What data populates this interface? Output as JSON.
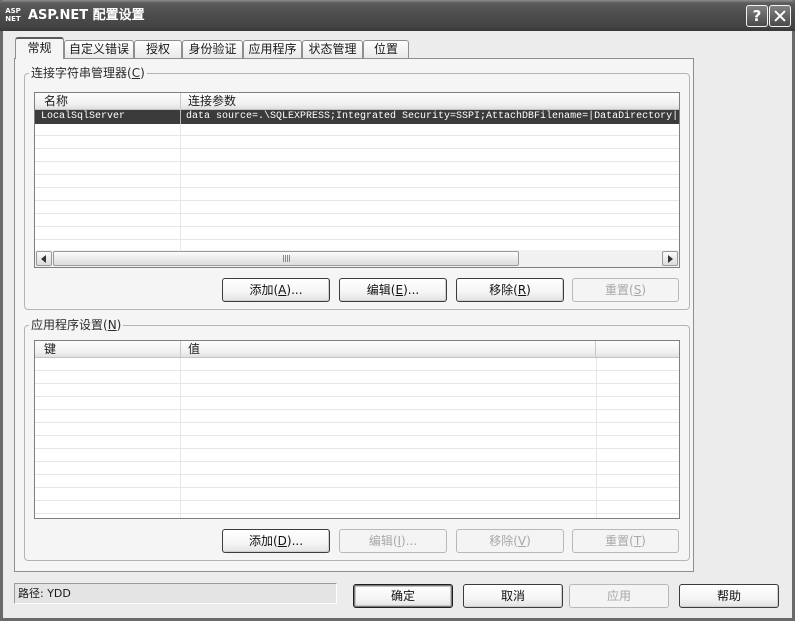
{
  "window": {
    "logo_top": "ASP",
    "logo_bottom": "NET",
    "title": "ASP.NET 配置设置",
    "help_glyph": "?"
  },
  "theme": {
    "title_bar": "#4d4d4d",
    "selection_bg": "#3b3b3b",
    "selection_text": "#ffffff",
    "dialog_bg": "#ececec",
    "page_bg": "#f5f5f5"
  },
  "icons": {
    "app_logo": "aspnet-logo-icon",
    "help": "help-icon",
    "close": "close-icon",
    "scroll_left": "chevron-left-icon",
    "scroll_right": "chevron-right-icon"
  },
  "tabs": [
    {
      "label": "常规",
      "selected": true
    },
    {
      "label": "自定义错误",
      "selected": false
    },
    {
      "label": "授权",
      "selected": false
    },
    {
      "label": "身份验证",
      "selected": false
    },
    {
      "label": "应用程序",
      "selected": false
    },
    {
      "label": "状态管理",
      "selected": false
    },
    {
      "label": "位置",
      "selected": false
    }
  ],
  "connection_strings": {
    "group_label": {
      "pre": "连接字符串管理器(",
      "key": "C",
      "post": ")"
    },
    "columns": [
      "名称",
      "连接参数"
    ],
    "rows": [
      {
        "name": "LocalSqlServer",
        "parameters": "data source=.\\SQLEXPRESS;Integrated Security=SSPI;AttachDBFilename=|DataDirectory|",
        "selected": true
      }
    ],
    "buttons": [
      {
        "pre": "添加(",
        "key": "A",
        "post": ")...",
        "enabled": true
      },
      {
        "pre": "编辑(",
        "key": "E",
        "post": ")...",
        "enabled": true
      },
      {
        "pre": "移除(",
        "key": "R",
        "post": ")",
        "enabled": true
      },
      {
        "pre": "重置(",
        "key": "S",
        "post": ")",
        "enabled": false
      }
    ]
  },
  "app_settings": {
    "group_label": {
      "pre": "应用程序设置(",
      "key": "N",
      "post": ")"
    },
    "columns": [
      "键",
      "值"
    ],
    "rows": [],
    "buttons": [
      {
        "pre": "添加(",
        "key": "D",
        "post": ")...",
        "enabled": true
      },
      {
        "pre": "编辑(",
        "key": "I",
        "post": ")...",
        "enabled": false
      },
      {
        "pre": "移除(",
        "key": "V",
        "post": ")",
        "enabled": false
      },
      {
        "pre": "重置(",
        "key": "T",
        "post": ")",
        "enabled": false
      }
    ]
  },
  "status": {
    "path": "路径: YDD"
  },
  "dialog_buttons": [
    {
      "label": "确定",
      "default": true,
      "enabled": true
    },
    {
      "label": "取消",
      "default": false,
      "enabled": true
    },
    {
      "label": "应用",
      "default": false,
      "enabled": false
    },
    {
      "label": "帮助",
      "default": false,
      "enabled": true
    }
  ]
}
